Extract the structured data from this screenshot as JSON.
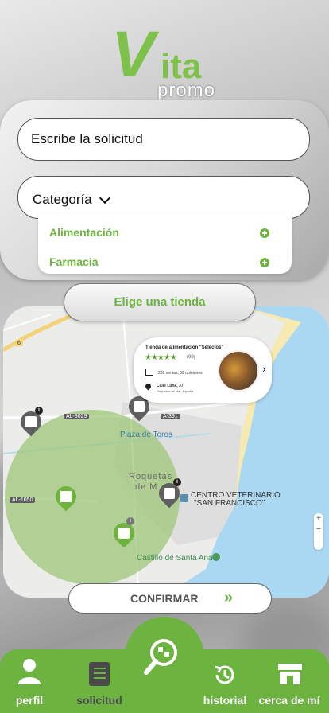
{
  "logo": {
    "main": "Vita",
    "sub": "promo"
  },
  "search": {
    "placeholder": "Escribe la solicitud",
    "category_label": "Categoría",
    "categories": [
      "Alimentación",
      "Farmacia"
    ]
  },
  "choose_store_label": "Elige una tienda",
  "map": {
    "labels": {
      "plaza": "Plaza de Toros",
      "town_line1": "Roquetas",
      "town_line2": "de M",
      "vet_line1": "CENTRO VETERINARIO",
      "vet_line2": "\"SAN FRANCISCO\"",
      "castle": "Castillo de Santa Ana"
    },
    "road_tags": {
      "a391": "A-391",
      "al9029": "AL-9029",
      "al1050": "AL-1050",
      "six": "6"
    },
    "store_card": {
      "name": "Tienda de alimentación \"Selectos\"",
      "stars": "★★★★★",
      "rating_count": "(99)",
      "sales_line": "209 ventas, 69 opiniones",
      "address_line1": "Calle Luna, 37",
      "address_line2": "Roquetas de Mar, España"
    },
    "zoom": {
      "plus": "+",
      "minus": "−"
    }
  },
  "confirm_label": "CONFIRMAR",
  "confirm_arrows": "»",
  "nav": [
    {
      "label": "perfil",
      "icon": "person-icon",
      "active": false
    },
    {
      "label": "solicitud",
      "icon": "clipboard-list-icon",
      "active": true
    },
    {
      "label": "historial",
      "icon": "history-icon",
      "active": false
    },
    {
      "label": "cerca de mí",
      "icon": "store-icon",
      "active": false
    }
  ],
  "center_icon": "search-magnifier-icon",
  "colors": {
    "brand_green": "#6cb33f",
    "map_water": "#aad7f2",
    "radius_fill": "#9fc77a"
  }
}
